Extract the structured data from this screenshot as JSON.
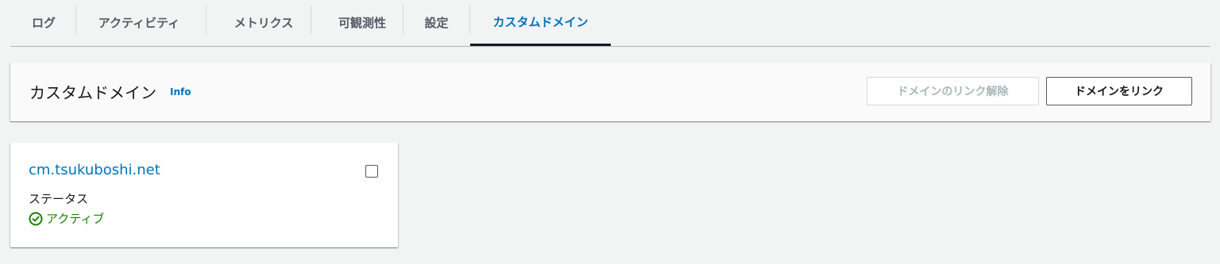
{
  "tabs": [
    {
      "label": "ログ"
    },
    {
      "label": "アクティビティ"
    },
    {
      "label": "メトリクス"
    },
    {
      "label": "可観測性"
    },
    {
      "label": "設定"
    },
    {
      "label": "カスタムドメイン",
      "active": true
    }
  ],
  "header": {
    "title": "カスタムドメイン",
    "info_label": "Info",
    "unlink_button": "ドメインのリンク解除",
    "link_button": "ドメインをリンク"
  },
  "card": {
    "domain": "cm.tsukuboshi.net",
    "status_label": "ステータス",
    "status_value": "アクティブ",
    "status_icon": "check-circle-icon"
  },
  "colors": {
    "accent": "#0073bb",
    "success": "#1d8102",
    "background": "#f2f3f3"
  }
}
